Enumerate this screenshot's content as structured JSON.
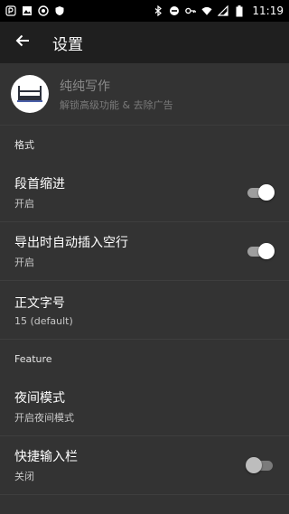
{
  "status_bar": {
    "time": "11:19",
    "left_icons": [
      "app-notification-icon",
      "image-icon",
      "record-icon",
      "shield-icon"
    ],
    "right_icons": [
      "bluetooth-icon",
      "do-not-disturb-icon",
      "key-icon",
      "wifi-icon",
      "signal-icon",
      "battery-icon"
    ]
  },
  "app_bar": {
    "title": "设置",
    "back_icon": "back-arrow-icon"
  },
  "promo": {
    "title": "纯纯写作",
    "subtitle": "解锁高级功能 & 去除广告"
  },
  "sections": [
    {
      "header": "格式",
      "items": [
        {
          "title": "段首缩进",
          "subtitle": "开启",
          "toggle": true
        },
        {
          "title": "导出时自动插入空行",
          "subtitle": "开启",
          "toggle": true
        },
        {
          "title": "正文字号",
          "subtitle": "15 (default)",
          "toggle": null
        }
      ]
    },
    {
      "header": "Feature",
      "items": [
        {
          "title": "夜间模式",
          "subtitle": "开启夜间模式",
          "toggle": null
        },
        {
          "title": "快捷输入栏",
          "subtitle": "关闭",
          "toggle": false
        }
      ]
    }
  ],
  "colors": {
    "status_bar": "#000000",
    "app_bar": "#1f1f1f",
    "background": "#333333",
    "divider": "#3e3e3e"
  }
}
